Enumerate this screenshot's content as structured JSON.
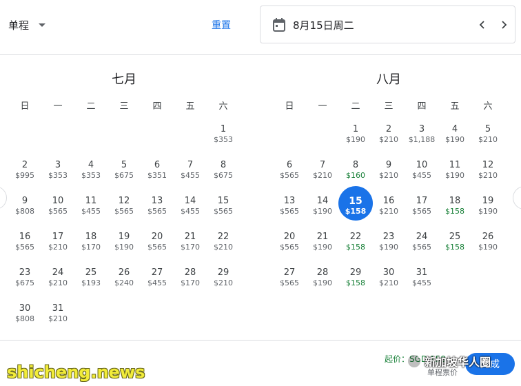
{
  "topbar": {
    "trip_type": "单程",
    "reset": "重置",
    "selected_date": "8月15日周二"
  },
  "weekdays": [
    "日",
    "一",
    "二",
    "三",
    "四",
    "五",
    "六"
  ],
  "months": [
    {
      "title": "七月",
      "offset": 6,
      "days": [
        {
          "d": "1",
          "p": "$353"
        },
        {
          "d": "2",
          "p": "$995"
        },
        {
          "d": "3",
          "p": "$353"
        },
        {
          "d": "4",
          "p": "$353"
        },
        {
          "d": "5",
          "p": "$675"
        },
        {
          "d": "6",
          "p": "$351"
        },
        {
          "d": "7",
          "p": "$455"
        },
        {
          "d": "8",
          "p": "$675"
        },
        {
          "d": "9",
          "p": "$808"
        },
        {
          "d": "10",
          "p": "$565"
        },
        {
          "d": "11",
          "p": "$455"
        },
        {
          "d": "12",
          "p": "$565"
        },
        {
          "d": "13",
          "p": "$565"
        },
        {
          "d": "14",
          "p": "$455"
        },
        {
          "d": "15",
          "p": "$565"
        },
        {
          "d": "16",
          "p": "$565"
        },
        {
          "d": "17",
          "p": "$210"
        },
        {
          "d": "18",
          "p": "$170"
        },
        {
          "d": "19",
          "p": "$190"
        },
        {
          "d": "20",
          "p": "$565"
        },
        {
          "d": "21",
          "p": "$170"
        },
        {
          "d": "22",
          "p": "$210"
        },
        {
          "d": "23",
          "p": "$675"
        },
        {
          "d": "24",
          "p": "$210"
        },
        {
          "d": "25",
          "p": "$193"
        },
        {
          "d": "26",
          "p": "$240"
        },
        {
          "d": "27",
          "p": "$455"
        },
        {
          "d": "28",
          "p": "$170"
        },
        {
          "d": "29",
          "p": "$210"
        },
        {
          "d": "30",
          "p": "$808"
        },
        {
          "d": "31",
          "p": "$210"
        }
      ]
    },
    {
      "title": "八月",
      "offset": 2,
      "days": [
        {
          "d": "1",
          "p": "$190"
        },
        {
          "d": "2",
          "p": "$210"
        },
        {
          "d": "3",
          "p": "$1,188"
        },
        {
          "d": "4",
          "p": "$190"
        },
        {
          "d": "5",
          "p": "$210"
        },
        {
          "d": "6",
          "p": "$565"
        },
        {
          "d": "7",
          "p": "$210"
        },
        {
          "d": "8",
          "p": "$160",
          "low": true
        },
        {
          "d": "9",
          "p": "$210"
        },
        {
          "d": "10",
          "p": "$455"
        },
        {
          "d": "11",
          "p": "$190"
        },
        {
          "d": "12",
          "p": "$210"
        },
        {
          "d": "13",
          "p": "$565"
        },
        {
          "d": "14",
          "p": "$190"
        },
        {
          "d": "15",
          "p": "$158",
          "low": true,
          "selected": true
        },
        {
          "d": "16",
          "p": "$210"
        },
        {
          "d": "17",
          "p": "$565"
        },
        {
          "d": "18",
          "p": "$158",
          "low": true
        },
        {
          "d": "19",
          "p": "$190"
        },
        {
          "d": "20",
          "p": "$565"
        },
        {
          "d": "21",
          "p": "$190"
        },
        {
          "d": "22",
          "p": "$158",
          "low": true
        },
        {
          "d": "23",
          "p": "$190"
        },
        {
          "d": "24",
          "p": "$565"
        },
        {
          "d": "25",
          "p": "$158",
          "low": true
        },
        {
          "d": "26",
          "p": "$190"
        },
        {
          "d": "27",
          "p": "$565"
        },
        {
          "d": "28",
          "p": "$190"
        },
        {
          "d": "29",
          "p": "$158",
          "low": true
        },
        {
          "d": "30",
          "p": "$210"
        },
        {
          "d": "31",
          "p": "$455"
        }
      ]
    }
  ],
  "footer": {
    "from_price": "起价：SGD 158",
    "note": "单程票价",
    "done": "完成"
  },
  "watermarks": {
    "left": "shicheng.news",
    "right": "新加坡华人圈"
  },
  "colors": {
    "accent": "#1a73e8",
    "low_price": "#188038",
    "text": "#202124",
    "muted": "#5f6368"
  }
}
